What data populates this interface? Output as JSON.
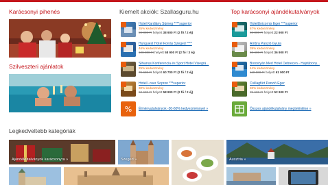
{
  "left": {
    "heading1": "Karácsonyi pihenés",
    "heading2": "Szilveszteri ajánlatok"
  },
  "middle": {
    "heading": "Kiemelt akciók: Szallasguru.hu",
    "deals": [
      {
        "name": "Hotel Kardiány Sümeg ****superior",
        "discount": "35% kedvezmény",
        "old": "59 800 Ft",
        "new": "38 900 Ft (2 fő / 2 éj)"
      },
      {
        "name": "Hunguest Hotel Forrás Szeged ****",
        "discount": "46% kedvezmény",
        "old": "108 800 Ft",
        "new": "58 900 Ft (2 fő / 3 éj)"
      },
      {
        "name": "Silvanus Konferencia és Sport Hotel Visegrá...",
        "discount": "25% kedvezmény",
        "old": "79 600 Ft",
        "new": "60 700 Ft (2 fő / 2 éj)"
      },
      {
        "name": "Hotel Lover Sopron ***superior",
        "discount": "30% kedvezmény",
        "old": "60 600 Ft",
        "new": "58 900 Ft (2 fő / 2 éj)"
      }
    ],
    "link": "Élményutalványok -30-60% kedvezménnyel »"
  },
  "right": {
    "heading": "Top karácsonyi ajándékutalványok",
    "deals": [
      {
        "name": "HotelUnicornis Eger ***superior",
        "discount": "67% kedvezmény",
        "old": "69 800 Ft",
        "new": "22 900 Ft"
      },
      {
        "name": "Ambra Panzió Gyula",
        "discount": "39% kedvezmény",
        "old": "59 400 Ft",
        "new": "36 900 Ft"
      },
      {
        "name": "Borostyán Med Hotel Debrecen - Hajdúbony...",
        "discount": "44% kedvezmény",
        "old": "110 000 Ft",
        "new": "61 900 Ft"
      },
      {
        "name": "Csillagfürt Panzió Eger",
        "discount": "33% kedvezmény",
        "old": "79 600 Ft",
        "new": "52 900 Ft"
      }
    ],
    "link": "Összes ajándékutalvány megtekintése »"
  },
  "categories": {
    "heading": "Legkedveltebb kategóriák",
    "items": [
      "Ajándékutalványok karácsonyra »",
      "Szeged »",
      "Ausztria »"
    ]
  },
  "strings": {
    "instead": "helyett"
  },
  "colors": {
    "brand": "#c4161c",
    "link": "#0a5fb0",
    "discount": "#e8700d"
  }
}
